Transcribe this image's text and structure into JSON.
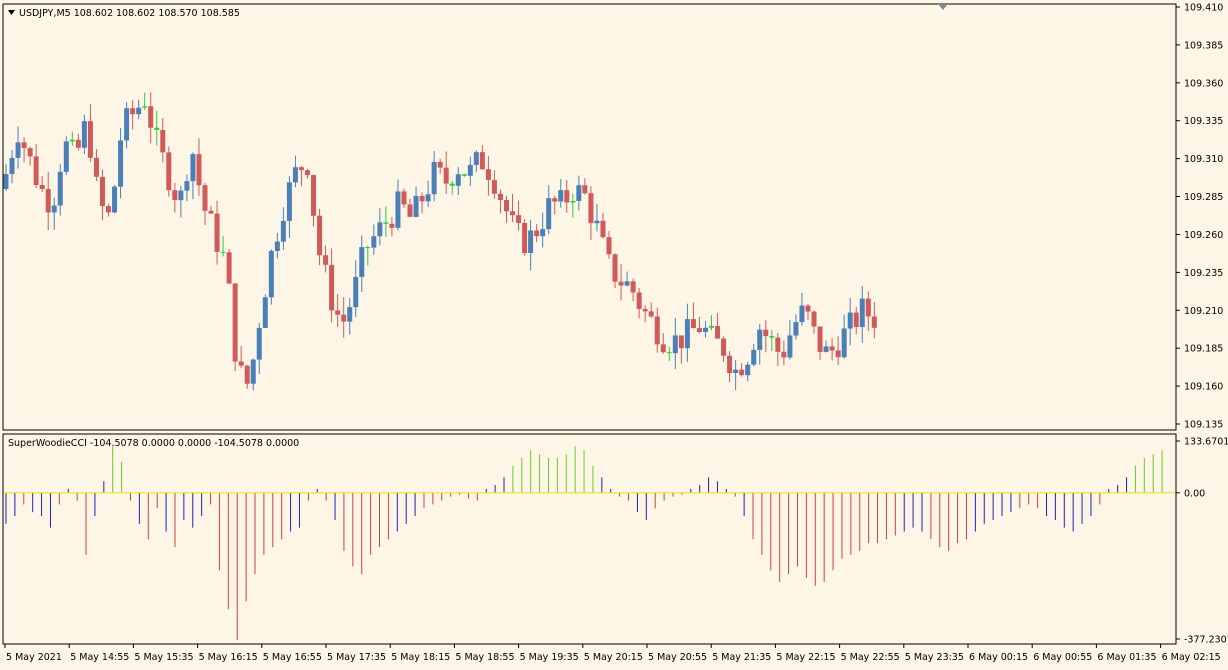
{
  "colors": {
    "background": "#fdf6e6",
    "bull_candle": "#4a7fb8",
    "bear_candle": "#d05a5a",
    "doji_candle": "#2ecc40",
    "cci_zero_line": "#e6e600",
    "cci_red": "#d04040",
    "cci_blue": "#2020c0",
    "cci_green": "#66cc22"
  },
  "main_panel": {
    "info_text": "USDJPY,M5  108.602 108.602 108.570 108.585",
    "price_scale": [
      "109.410",
      "109.385",
      "109.360",
      "109.335",
      "109.310",
      "109.285",
      "109.260",
      "109.235",
      "109.210",
      "109.185",
      "109.160",
      "109.135"
    ]
  },
  "indicator_panel": {
    "info_text": "SuperWoodieCCI -104.5078 0.0000 0.0000 -104.5078 0.0000",
    "scale": [
      "133.6701",
      "0.00",
      "-377.2307"
    ]
  },
  "time_axis": [
    "5 May 2021",
    "5 May 14:55",
    "5 May 15:35",
    "5 May 16:15",
    "5 May 16:55",
    "5 May 17:35",
    "5 May 18:15",
    "5 May 18:55",
    "5 May 19:35",
    "5 May 20:15",
    "5 May 20:55",
    "5 May 21:35",
    "5 May 22:15",
    "5 May 22:55",
    "5 May 23:35",
    "6 May 00:15",
    "6 May 00:55",
    "6 May 01:35",
    "6 May 02:15"
  ],
  "chart_data": [
    {
      "type": "candlestick",
      "title": "USDJPY,M5",
      "ylim": [
        109.135,
        109.41
      ],
      "x": [
        "5 May 2021",
        "5 May 14:55",
        "5 May 15:35",
        "5 May 16:15",
        "5 May 16:55",
        "5 May 17:35",
        "5 May 18:15",
        "5 May 18:55",
        "5 May 19:35",
        "5 May 20:15",
        "5 May 20:55",
        "5 May 21:35",
        "5 May 22:15",
        "5 May 22:55",
        "5 May 23:35",
        "6 May 00:15",
        "6 May 00:55",
        "6 May 01:35",
        "6 May 02:15"
      ],
      "close_path": [
        109.3,
        109.33,
        109.31,
        109.29,
        109.28,
        109.32,
        109.31,
        109.335,
        109.28,
        109.27,
        109.33,
        109.34,
        109.35,
        109.32,
        109.3,
        109.28,
        109.32,
        109.28,
        109.26,
        109.24,
        109.17,
        109.16,
        109.21,
        109.25,
        109.28,
        109.3,
        109.31,
        109.25,
        109.22,
        109.2,
        109.22,
        109.25,
        109.26,
        109.27,
        109.28,
        109.27,
        109.285,
        109.3,
        109.295,
        109.305,
        109.3,
        109.31,
        109.3,
        109.28,
        109.26,
        109.255,
        109.265,
        109.28,
        109.28,
        109.29,
        109.285,
        109.265,
        109.24,
        109.23,
        109.225,
        109.21,
        109.2,
        109.19,
        109.19,
        109.195,
        109.2,
        109.19,
        109.185,
        109.17,
        109.18,
        109.2,
        109.19,
        109.18,
        109.2,
        109.21,
        109.19,
        109.18,
        109.19,
        109.2,
        109.21,
        109.205
      ]
    },
    {
      "type": "bar",
      "title": "SuperWoodieCCI",
      "ylim": [
        -377.2307,
        133.6701
      ],
      "series": [
        {
          "name": "SuperWoodieCCI",
          "last_value": -104.5078
        }
      ],
      "values": [
        -80,
        -60,
        -30,
        -50,
        -60,
        -90,
        -30,
        10,
        -20,
        -160,
        -60,
        30,
        120,
        80,
        -20,
        -80,
        -120,
        -40,
        -100,
        -140,
        -70,
        -90,
        -60,
        -30,
        -200,
        -300,
        -380,
        -280,
        -210,
        -160,
        -140,
        -120,
        -100,
        -90,
        -20,
        10,
        -20,
        -70,
        -150,
        -190,
        -210,
        -160,
        -140,
        -120,
        -100,
        -80,
        -60,
        -40,
        -30,
        -20,
        -10,
        -5,
        -15,
        -20,
        10,
        20,
        40,
        70,
        90,
        110,
        100,
        90,
        90,
        100,
        120,
        110,
        70,
        40,
        10,
        -10,
        -20,
        -50,
        -70,
        -40,
        -20,
        -10,
        -5,
        10,
        20,
        40,
        30,
        10,
        -10,
        -60,
        -120,
        -160,
        -200,
        -230,
        -210,
        -190,
        -220,
        -240,
        -230,
        -200,
        -170,
        -160,
        -150,
        -130,
        -130,
        -120,
        -110,
        -100,
        -90,
        -100,
        -120,
        -140,
        -150,
        -130,
        -120,
        -100,
        -80,
        -70,
        -60,
        -50,
        -40,
        -30,
        -40,
        -60,
        -70,
        -90,
        -100,
        -80,
        -60,
        -30,
        10,
        20,
        40,
        70,
        90,
        100,
        110
      ]
    }
  ]
}
